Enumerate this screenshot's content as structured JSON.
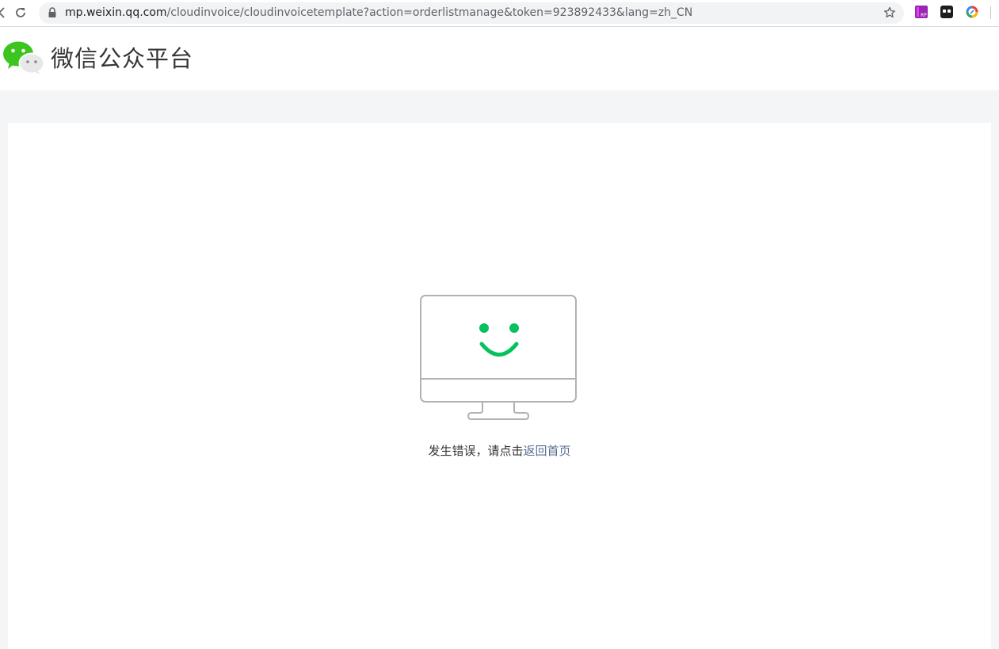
{
  "browser": {
    "url_host": "mp.weixin.qq.com",
    "url_path": "/cloudinvoice/cloudinvoicetemplate?action=orderlistmanage&token=923892433&lang=zh_CN",
    "extensions": [
      {
        "name": "rp-extension-icon",
        "label": "RP"
      },
      {
        "name": "mask-extension-icon",
        "label": ""
      },
      {
        "name": "circle-extension-icon",
        "label": ""
      }
    ]
  },
  "header": {
    "site_title": "微信公众平台",
    "logo_icon": "wechat-logo-icon"
  },
  "main": {
    "illustration_icon": "smiling-monitor-icon",
    "error_message": "发生错误，请点击",
    "home_link_label": "返回首页"
  },
  "colors": {
    "wechat_green": "#07c160",
    "link_blue": "#576b95",
    "page_background": "#f4f5f7"
  }
}
